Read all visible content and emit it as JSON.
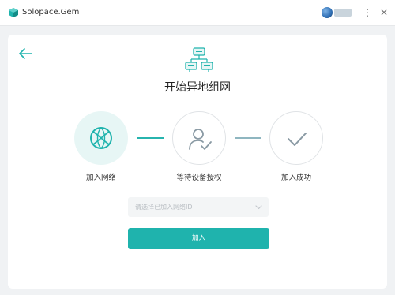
{
  "window": {
    "app_title": "Solopace.Gem",
    "menu_glyph": "⋮",
    "close_glyph": "✕"
  },
  "colors": {
    "accent": "#1fb3ad",
    "accent_light": "#e7f6f5",
    "border": "#e0e3e6",
    "background": "#f0f2f4"
  },
  "page": {
    "title": "开始异地组网",
    "hero_icon": "network-topology-icon",
    "back_icon": "back-arrow-icon"
  },
  "steps": [
    {
      "label": "加入网络",
      "icon": "globe-icon",
      "state": "active"
    },
    {
      "label": "等待设备授权",
      "icon": "user-check-icon",
      "state": "pending"
    },
    {
      "label": "加入成功",
      "icon": "checkmark-icon",
      "state": "pending"
    }
  ],
  "form": {
    "network_select_placeholder": "请选择已加入网络ID",
    "join_button_label": "加入"
  }
}
